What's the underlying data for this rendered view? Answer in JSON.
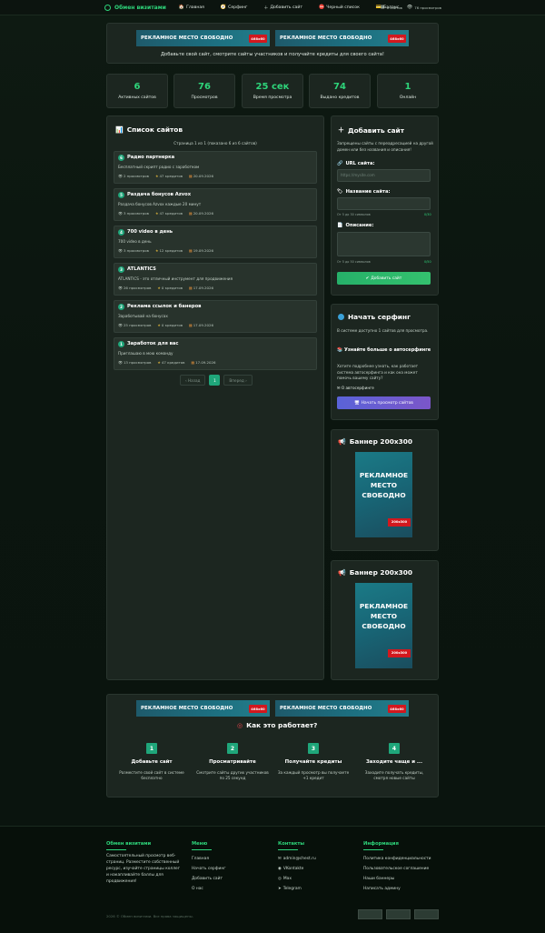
{
  "nav": {
    "brand": "Обмен визитами",
    "items": [
      {
        "icon": "home-icon",
        "glyph": "🏠",
        "label": "Главная"
      },
      {
        "icon": "surfing-icon",
        "glyph": "🧭",
        "label": "Серфинг"
      },
      {
        "icon": "plus-icon",
        "glyph": "＋",
        "label": "Добавить сайт"
      },
      {
        "icon": "blacklist-icon",
        "glyph": "⛔",
        "label": "Черный список"
      },
      {
        "icon": "balance-icon",
        "glyph": "💳",
        "label": "Баланс"
      }
    ],
    "right": [
      {
        "icon": "sites-icon",
        "glyph": "▦",
        "label": "6 сайтов"
      },
      {
        "icon": "views-icon",
        "glyph": "👁",
        "label": "76 просмотров"
      }
    ]
  },
  "banners": {
    "text468": "РЕКЛАМНОЕ  МЕСТО СВОБОДНО",
    "size468": "468x60",
    "caption": "Добавьте свой сайт, смотрите сайты участников и получайте кредиты для своего сайта!",
    "text200": [
      "РЕКЛАМНОЕ",
      "МЕСТО",
      "СВОБОДНО"
    ],
    "size200": "200x300"
  },
  "stats": [
    {
      "value": "6",
      "label": "Активных сайтов"
    },
    {
      "value": "76",
      "label": "Просмотров"
    },
    {
      "value": "25 сек",
      "label": "Время просмотра"
    },
    {
      "value": "74",
      "label": "Выдано кредитов"
    },
    {
      "value": "1",
      "label": "Онлайн"
    }
  ],
  "sites_list": {
    "title": "Список сайтов",
    "page_info": "Страница 1 из 1 (показано 6 из 6 сайтов)",
    "items": [
      {
        "num": "6",
        "name": "Радио партнерка",
        "desc": "Бесплатный скрипт радио с заработком",
        "views": "2 просмотров",
        "credits": "47 кредитов",
        "date": "20.09.2026"
      },
      {
        "num": "5",
        "name": "Раздача бонусов Azvox",
        "desc": "Раздача бонусов Azvox каждые 20 минут",
        "views": "3 просмотров",
        "credits": "47 кредитов",
        "date": "20.09.2026"
      },
      {
        "num": "4",
        "name": "700 video в день",
        "desc": "700 video в день",
        "views": "3 просмотров",
        "credits": "12 кредитов",
        "date": "19.09.2026"
      },
      {
        "num": "3",
        "name": "ATLANTICS",
        "desc": "ATLANTICS - это отличный инструмент для продвижения",
        "views": "26 просмотров",
        "credits": "0 кредитов",
        "date": "17.09.2026"
      },
      {
        "num": "2",
        "name": "Реклама ссылок и банеров",
        "desc": "Заработывай на бонусах",
        "views": "25 просмотров",
        "credits": "0 кредитов",
        "date": "17.09.2026"
      },
      {
        "num": "1",
        "name": "Заработок для вас",
        "desc": "Приглашаю в мою команду",
        "views": "13 просмотров",
        "credits": "47 кредитов",
        "date": "17.09.2026"
      }
    ],
    "pager": {
      "prev": "‹ Назад",
      "current": "1",
      "next": "Вперед ›"
    }
  },
  "add_site": {
    "title": "Добавить сайт",
    "note": "Запрещены сайты с переадресацией на другой домен или без названия и описания!",
    "url_label": "URL сайта:",
    "url_placeholder": "https://mysite.com",
    "name_label": "Название сайта:",
    "name_hint": "От 5 до 30 символов",
    "name_count": "0/30",
    "desc_label": "Описание:",
    "desc_hint": "От 5 до 50 символов",
    "desc_count": "0/50",
    "button": "Добавить сайт"
  },
  "surf": {
    "title": "Начать серфинг",
    "available": "В системе доступно 1 сайтов для просмотра.",
    "more_title": "Узнайте больше о автосерфинге",
    "more_text": "Хотите подробнее узнать, как работает система автосерфинга и как она может помочь вашему сайту?",
    "link": "О автосерфинге",
    "button": "Начать просмотр сайтов"
  },
  "side_banners": [
    {
      "title": "Баннер 200x300"
    },
    {
      "title": "Баннер 200x300"
    }
  ],
  "how": {
    "title": "Как это работает?",
    "steps": [
      {
        "num": "1",
        "title": "Добавьте сайт",
        "desc": "Разместите свой сайт в системе бесплатно"
      },
      {
        "num": "2",
        "title": "Просматривайте",
        "desc": "Смотрите сайты других участников по 25 секунд"
      },
      {
        "num": "3",
        "title": "Получайте кредиты",
        "desc": "За каждый просмотр вы получаете +1 кредит"
      },
      {
        "num": "4",
        "title": "Заходите чаще и ...",
        "desc": "Заходите получать кредиты, смотря новые сайты"
      }
    ]
  },
  "footer": {
    "col1_title": "Обмен визитами",
    "col1_text": "Самостоятельный просмотр веб-страниц. Разместите собственный ресурс, изучайте страницы коллег и накапливайте баллы для продвижения!",
    "col2_title": "Меню",
    "col2_links": [
      "Главная",
      "Начать серфинг",
      "Добавить сайт",
      "О нас"
    ],
    "col3_title": "Контакты",
    "col3_links": [
      {
        "glyph": "✉",
        "label": "admin@chest.ru"
      },
      {
        "glyph": "◉",
        "label": "VKontakte"
      },
      {
        "glyph": "◎",
        "label": "Max"
      },
      {
        "glyph": "➤",
        "label": "Telegram"
      }
    ],
    "col4_title": "Информация",
    "col4_links": [
      "Политика конфиденциальности",
      "Пользовательское соглашение",
      "Наши баннеры",
      "Написать админу"
    ],
    "copyright": "2026 © Обмен визитами. Все права защищены."
  }
}
